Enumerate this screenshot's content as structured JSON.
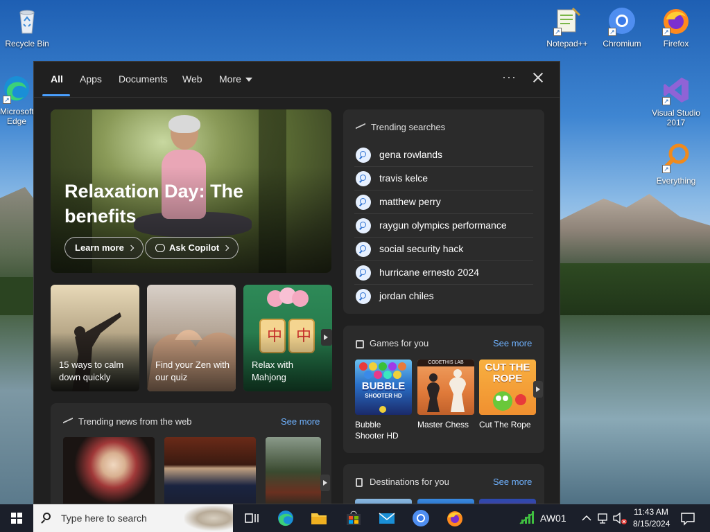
{
  "desktop": {
    "icons": [
      {
        "label": "Recycle Bin",
        "icon": "recycle-bin-icon"
      },
      {
        "label": "Microsoft Edge",
        "icon": "edge-icon"
      },
      {
        "label": "Notepad++",
        "icon": "notepad-plus-plus-icon"
      },
      {
        "label": "Chromium",
        "icon": "chromium-icon"
      },
      {
        "label": "Firefox",
        "icon": "firefox-icon"
      },
      {
        "label": "Visual Studio 2017",
        "icon": "visual-studio-icon"
      },
      {
        "label": "Everything",
        "icon": "everything-icon"
      }
    ]
  },
  "search_panel": {
    "tabs": [
      {
        "label": "All",
        "active": true
      },
      {
        "label": "Apps"
      },
      {
        "label": "Documents"
      },
      {
        "label": "Web"
      },
      {
        "label": "More"
      }
    ],
    "options_label": "···",
    "hero": {
      "title": "Relaxation Day: The benefits",
      "learn_more": "Learn more",
      "ask_copilot": "Ask Copilot"
    },
    "cards": [
      {
        "text": "15 ways to calm down quickly"
      },
      {
        "text": "Find your Zen with our quiz"
      },
      {
        "text": "Relax with Mahjong"
      }
    ],
    "mahjong_glyph": "中",
    "trending_news": {
      "title": "Trending news from the web",
      "see_more": "See more"
    },
    "trending_searches": {
      "title": "Trending searches",
      "items": [
        "gena rowlands",
        "travis kelce",
        "matthew perry",
        "raygun olympics performance",
        "social security hack",
        "hurricane ernesto 2024",
        "jordan chiles"
      ]
    },
    "games": {
      "title": "Games for you",
      "see_more": "See more",
      "items": [
        {
          "name": "Bubble Shooter HD",
          "art_text": "BUBBLE",
          "art_sub": "SHOOTER HD"
        },
        {
          "name": "Master Chess",
          "art_text": "CODETHIS LAB"
        },
        {
          "name": "Cut The Rope",
          "art_text": "CUT THE ROPE"
        }
      ]
    },
    "destinations": {
      "title": "Destinations for you",
      "see_more": "See more"
    }
  },
  "taskbar": {
    "search_placeholder": "Type here to search",
    "network_label": "AW01",
    "time": "11:43 AM",
    "date": "8/15/2024"
  },
  "colors": {
    "accent": "#4aa0ff",
    "link": "#6fb2ff",
    "panel_bg": "#202020",
    "card_bg": "#2b2b2b"
  }
}
